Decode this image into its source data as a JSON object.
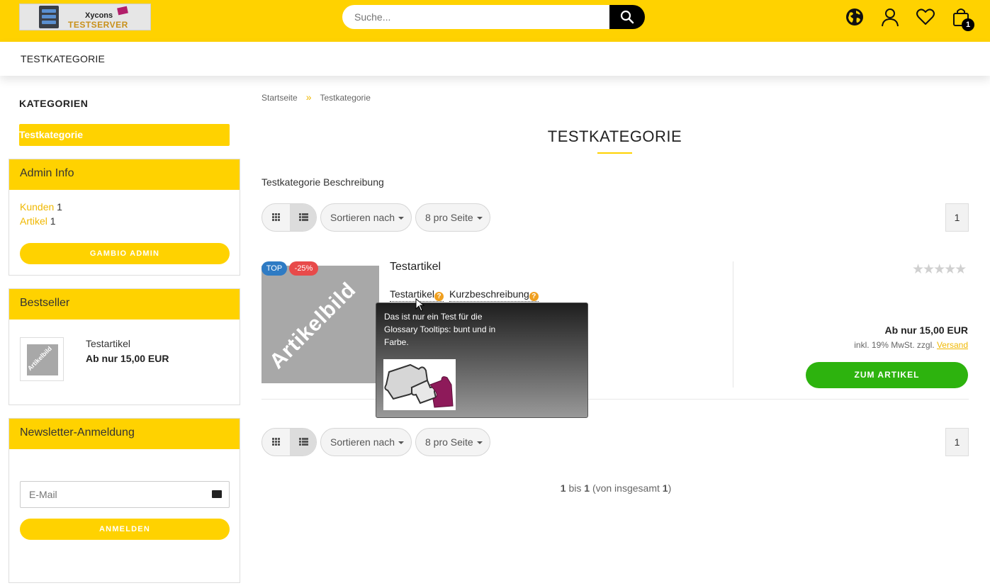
{
  "header": {
    "logo": {
      "line1": "Xycons",
      "line2": "TESTSERVER"
    },
    "search": {
      "placeholder": "Suche..."
    },
    "cart_count": "1",
    "icons": [
      "globe-icon",
      "user-icon",
      "heart-icon",
      "shopping-bag-icon",
      "search-icon"
    ]
  },
  "nav": {
    "items": [
      "TESTKATEGORIE"
    ]
  },
  "sidebar": {
    "categories_title": "KATEGORIEN",
    "categories": [
      {
        "label": "Testkategorie",
        "active": true
      }
    ],
    "admin_info": {
      "title": "Admin Info",
      "rows": [
        {
          "label": "Kunden",
          "value": "1"
        },
        {
          "label": "Artikel",
          "value": "1"
        }
      ],
      "button": "GAMBIO ADMIN"
    },
    "bestseller": {
      "title": "Bestseller",
      "thumb_label": "Artikelbild",
      "item_name": "Testartikel",
      "item_price": "Ab nur 15,00 EUR"
    },
    "newsletter": {
      "title": "Newsletter-Anmeldung",
      "email_placeholder": "E-Mail",
      "button": "ANMELDEN"
    }
  },
  "main": {
    "breadcrumb": [
      "Startseite",
      "Testkategorie"
    ],
    "breadcrumb_separator": "»",
    "title": "TESTKATEGORIE",
    "description": "Testkategorie Beschreibung",
    "toolbar": {
      "sort_label": "Sortieren nach",
      "per_page_label": "8 pro Seite",
      "page": "1"
    },
    "product": {
      "badge_top": "TOP",
      "badge_sale": "-25%",
      "image_label": "Artikelbild",
      "name": "Testartikel",
      "glossary_1": "Testartikel",
      "glossary_2": "Kurzbeschreibung",
      "rating": 0,
      "price": "Ab nur 15,00 EUR",
      "tax_text": "inkl. 19% MwSt. zzgl.",
      "shipping_link": "Versand",
      "button": "ZUM ARTIKEL"
    },
    "tooltip": {
      "text": "Das ist nur ein Test für die Glossary Tooltips: bunt und in Farbe."
    },
    "summary": {
      "from": "1",
      "bis": "bis",
      "to": "1",
      "pre_total": "(von insgesamt",
      "total": "1",
      "post": ")"
    }
  },
  "colors": {
    "brand_yellow": "#ffd200",
    "cta_green": "#2db30e",
    "badge_blue": "#2e7bc4",
    "badge_red": "#e84a4a"
  }
}
